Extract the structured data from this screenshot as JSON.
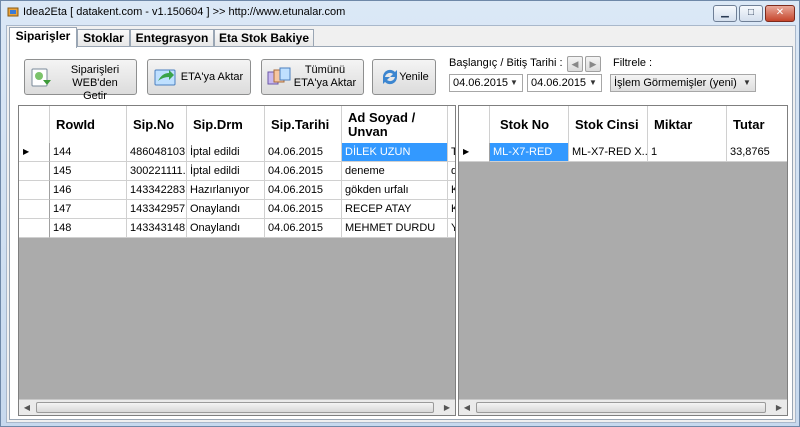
{
  "window": {
    "title": "Idea2Eta [ datakent.com - v1.150604 ]  >> http://www.etunalar.com"
  },
  "tabs": [
    "Siparişler",
    "Stoklar",
    "Entegrasyon",
    "Eta Stok Bakiye"
  ],
  "toolbar": {
    "fetch_label": "Siparişleri WEB'den Getir",
    "export_label": "ETA'ya Aktar",
    "export_all_label": "Tümünü ETA'ya Aktar",
    "refresh_label": "Yenile"
  },
  "date_filter": {
    "label": "Başlangıç / Bitiş Tarihi :",
    "start": "04.06.2015",
    "end": "04.06.2015"
  },
  "filter": {
    "label": "Filtrele :",
    "value": "İşlem Görmemişler (yeni)"
  },
  "orders": {
    "columns": [
      "RowId",
      "Sip.No",
      "Sip.Drm",
      "Sip.Tarihi",
      "Ad Soyad / Unvan"
    ],
    "rows": [
      [
        "144",
        "486048103...",
        "İptal edildi",
        "04.06.2015",
        "DİLEK UZUN"
      ],
      [
        "145",
        "300221111...",
        "İptal edildi",
        "04.06.2015",
        "deneme"
      ],
      [
        "146",
        "143342283...",
        "Hazırlanıyor",
        "04.06.2015",
        "gökden urfalı"
      ],
      [
        "147",
        "143342957...",
        "Onaylandı",
        "04.06.2015",
        "RECEP ATAY"
      ],
      [
        "148",
        "143343148...",
        "Onaylandı",
        "04.06.2015",
        "MEHMET DURDU"
      ]
    ],
    "overflow": [
      "T",
      "d",
      "K",
      "K",
      "Y"
    ],
    "current_row_marker": "▶"
  },
  "items": {
    "columns": [
      "Stok No",
      "Stok Cinsi",
      "Miktar",
      "Tutar"
    ],
    "rows": [
      [
        "ML-X7-RED",
        "ML-X7-RED X...",
        "1",
        "33,8765"
      ]
    ],
    "current_row_marker": "▶"
  },
  "colors": {
    "selection": "#3399ff",
    "grid_background": "#ababab"
  }
}
